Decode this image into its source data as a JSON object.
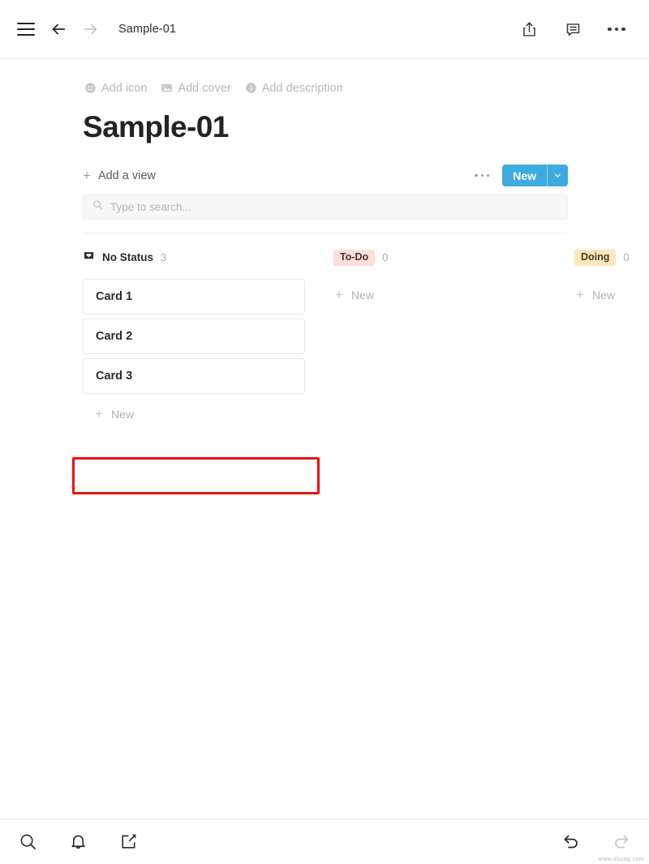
{
  "topbar": {
    "menu_icon": "hamburger-menu-icon",
    "back_icon": "arrow-left-icon",
    "forward_icon": "arrow-right-icon",
    "title": "Sample-01",
    "share_icon": "share-icon",
    "comment_icon": "comment-icon",
    "more_icon": "more-horizontal-icon"
  },
  "page": {
    "meta": [
      {
        "icon": "smiley-icon",
        "label": "Add icon"
      },
      {
        "icon": "image-icon",
        "label": "Add cover"
      },
      {
        "icon": "info-icon",
        "label": "Add description"
      }
    ],
    "title": "Sample-01"
  },
  "viewbar": {
    "add_view_label": "Add a view",
    "plus": "+",
    "more_icon": "more-horizontal-icon",
    "new_label": "New",
    "caret_icon": "chevron-down-icon",
    "new_button_color": "#3dabe0"
  },
  "search": {
    "icon": "search-icon",
    "placeholder": "Type to search...",
    "value": ""
  },
  "board": {
    "columns": [
      {
        "name": "No Status",
        "icon": "inbox-tray-icon",
        "style": "plain",
        "count": "3",
        "cards": [
          {
            "title": "Card 1"
          },
          {
            "title": "Card 2"
          },
          {
            "title": "Card 3"
          }
        ],
        "new_label": "New",
        "plus": "+",
        "highlighted": true
      },
      {
        "name": "To-Do",
        "icon": "",
        "style": "chip-todo",
        "chip_color": "#fbdfdb",
        "count": "0",
        "cards": [],
        "new_label": "New",
        "plus": "+",
        "highlighted": false
      },
      {
        "name": "Doing",
        "icon": "",
        "style": "chip-doing",
        "chip_color": "#fbe7bd",
        "count": "0",
        "cards": [],
        "new_label": "New",
        "plus": "+",
        "highlighted": false
      }
    ]
  },
  "bottombar": {
    "search_icon": "search-icon",
    "notifications_icon": "bell-icon",
    "compose_icon": "compose-icon",
    "undo_icon": "undo-arrow-icon",
    "redo_icon": "redo-arrow-icon",
    "watermark": "www.dsuag.com"
  },
  "annotation": {
    "highlight_color": "#e8140f",
    "target": "new-card-button-no-status"
  }
}
